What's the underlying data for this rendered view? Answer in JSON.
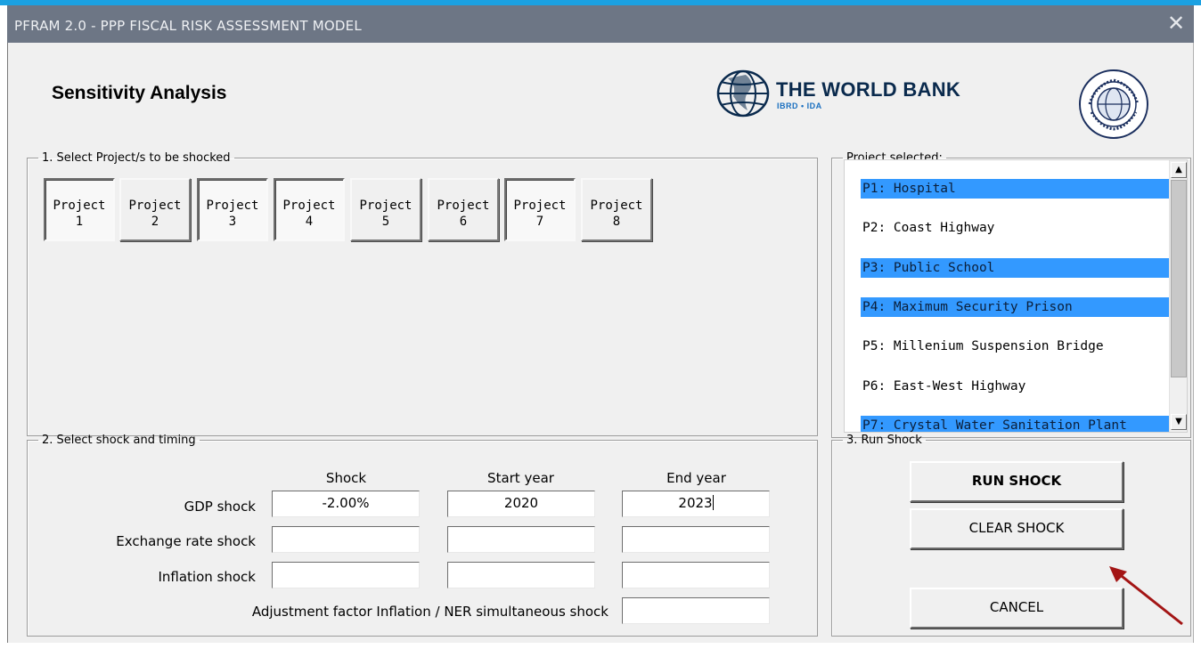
{
  "window": {
    "title": "PFRAM 2.0 - PPP FISCAL RISK ASSESSMENT MODEL",
    "close_glyph": "✕"
  },
  "heading": "Sensitivity Analysis",
  "logos": {
    "world_bank": {
      "name": "THE WORLD BANK",
      "sub": "IBRD • IDA"
    },
    "imf_seal": {
      "text": "INTERNATIONAL MONETARY FUND"
    }
  },
  "section1": {
    "legend": "1.  Select Project/s to be shocked",
    "projects": [
      {
        "line1": "Project",
        "line2": "1",
        "pressed": true
      },
      {
        "line1": "Project",
        "line2": "2",
        "pressed": false
      },
      {
        "line1": "Project",
        "line2": "3",
        "pressed": true
      },
      {
        "line1": "Project",
        "line2": "4",
        "pressed": true
      },
      {
        "line1": "Project",
        "line2": "5",
        "pressed": false
      },
      {
        "line1": "Project",
        "line2": "6",
        "pressed": false
      },
      {
        "line1": "Project",
        "line2": "7",
        "pressed": true
      },
      {
        "line1": "Project",
        "line2": "8",
        "pressed": false
      }
    ]
  },
  "selected_panel": {
    "legend": "Project selected:",
    "items": [
      {
        "label": "P1: Hospital",
        "selected": true
      },
      {
        "label": "P2: Coast Highway",
        "selected": false
      },
      {
        "label": "P3: Public School",
        "selected": true
      },
      {
        "label": "P4: Maximum Security Prison",
        "selected": true
      },
      {
        "label": "P5: Millenium Suspension Bridge",
        "selected": false
      },
      {
        "label": "P6: East-West Highway",
        "selected": false
      },
      {
        "label": "P7: Crystal Water Sanitation Plant",
        "selected": true
      }
    ],
    "scroll_up": "▲",
    "scroll_down": "▼"
  },
  "section2": {
    "legend": "2. Select shock and timing",
    "columns": {
      "shock": "Shock",
      "start": "Start year",
      "end": "End year"
    },
    "rows": {
      "gdp": {
        "label": "GDP shock",
        "shock": "-2.00%",
        "start": "2020",
        "end": "2023"
      },
      "exchange": {
        "label": "Exchange rate shock",
        "shock": "",
        "start": "",
        "end": ""
      },
      "inflation": {
        "label": "Inflation shock",
        "shock": "",
        "start": "",
        "end": ""
      }
    },
    "adjustment": {
      "label": "Adjustment factor Inflation / NER simultaneous shock",
      "value": ""
    }
  },
  "section3": {
    "legend": "3. Run Shock",
    "run": "RUN SHOCK",
    "clear": "CLEAR SHOCK",
    "cancel": "CANCEL"
  },
  "colors": {
    "title_bar": "#6d7685",
    "selection": "#3399ff",
    "annotation_arrow": "#a31515"
  }
}
